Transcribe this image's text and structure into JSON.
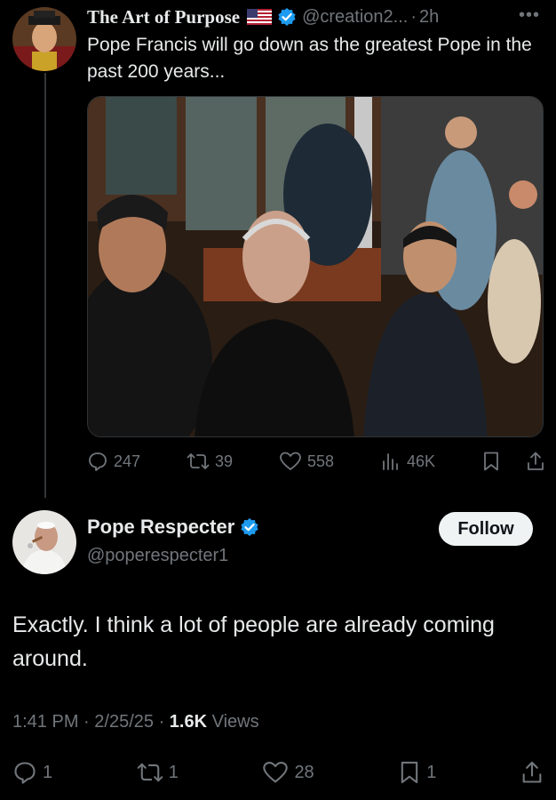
{
  "tweet1": {
    "display_name": "The Art of Purpose",
    "handle": "@creation2...",
    "separator": "·",
    "time": "2h",
    "more": "•••",
    "text": "Pope Francis will go down as the greatest Pope in the past 200 years...",
    "stats": {
      "replies": "247",
      "reposts": "39",
      "likes": "558",
      "views": "46K"
    }
  },
  "tweet2": {
    "display_name": "Pope Respecter",
    "handle": "@poperespecter1",
    "follow_label": "Follow",
    "text": "Exactly. I think a lot of people are already coming around.",
    "time": "1:41 PM",
    "date": "2/25/25",
    "views_count": "1.6K",
    "views_label": "Views",
    "stats": {
      "replies": "1",
      "reposts": "1",
      "likes": "28",
      "bookmarks": "1"
    }
  },
  "icons": [
    "reply-icon",
    "repost-icon",
    "like-icon",
    "views-icon",
    "bookmark-icon",
    "share-icon",
    "verified-icon",
    "us-flag-icon"
  ],
  "colors": {
    "background": "#000000",
    "text_primary": "#e7e9ea",
    "text_secondary": "#71767b",
    "verified_blue": "#1d9bf0",
    "follow_button_bg": "#eff3f4",
    "thread_line": "#333639"
  }
}
